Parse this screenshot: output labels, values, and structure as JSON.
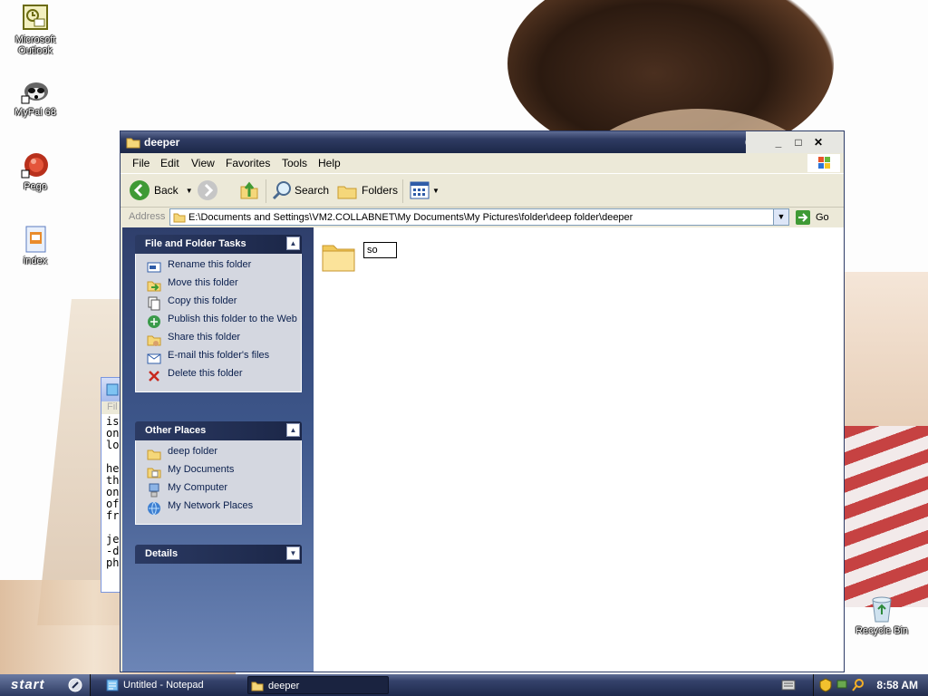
{
  "desktop": {
    "icons": [
      {
        "label": "Microsoft Outlook",
        "icon": "outlook-icon"
      },
      {
        "label": "MyPal 68",
        "icon": "raccoon-icon"
      },
      {
        "label": "Pego",
        "icon": "pego-icon"
      },
      {
        "label": "index",
        "icon": "document-icon"
      },
      {
        "label": "Recycle Bin",
        "icon": "recycle-bin-icon"
      }
    ]
  },
  "notepad_bg": {
    "menu": "Fil",
    "lines": [
      "is",
      "on",
      "lo",
      "",
      "he",
      "th",
      "on",
      "of",
      "fr",
      "",
      "je",
      "-d",
      "ph"
    ]
  },
  "window": {
    "title": "deeper",
    "menu": [
      "File",
      "Edit",
      "View",
      "Favorites",
      "Tools",
      "Help"
    ],
    "toolbar": {
      "back": "Back",
      "search": "Search",
      "folders": "Folders"
    },
    "address": {
      "label": "Address",
      "path": "E:\\Documents and Settings\\VM2.COLLABNET\\My Documents\\My Pictures\\folder\\deep folder\\deeper",
      "go": "Go"
    },
    "file_tasks": {
      "title": "File and Folder Tasks",
      "items": [
        "Rename this folder",
        "Move this folder",
        "Copy this folder",
        "Publish this folder to the Web",
        "Share this folder",
        "E-mail this folder's files",
        "Delete this folder"
      ]
    },
    "other_places": {
      "title": "Other Places",
      "items": [
        "deep folder",
        "My Documents",
        "My Computer",
        "My Network Places"
      ]
    },
    "details": {
      "title": "Details"
    },
    "content": {
      "rename_value": "so"
    }
  },
  "taskbar": {
    "start": "start",
    "items": [
      "Untitled - Notepad",
      "deeper"
    ],
    "clock": "8:58 AM"
  },
  "colors": {
    "title_dark": "#1c2748",
    "pane_blue": "#3d568a",
    "link_text": "#0a1f4d"
  }
}
